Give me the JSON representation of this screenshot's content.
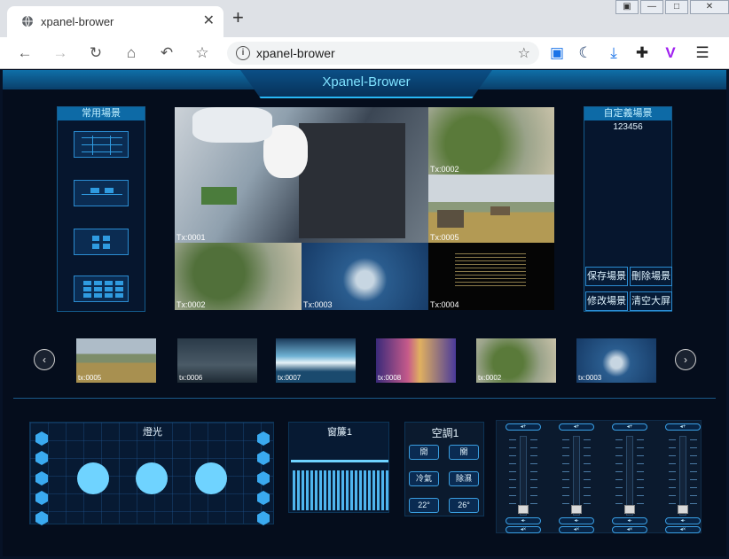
{
  "browser": {
    "tab_title": "xpanel-brower",
    "tab_close": "✕",
    "new_tab": "+",
    "url": "xpanel-brower",
    "window_controls": [
      "▣",
      "—",
      "□",
      "✕"
    ]
  },
  "app": {
    "title": "Xpanel-Brower",
    "common_scenes": {
      "title": "常用場景"
    },
    "custom_scenes": {
      "title": "自定義場景",
      "items": [
        "123456"
      ],
      "buttons": [
        "保存場景",
        "刪除場景",
        "修改場景",
        "清空大屏"
      ]
    },
    "video_wall": {
      "tiles": [
        "Tx:0001",
        "Tx:0002",
        "Tx:0005",
        "Tx:0002",
        "Tx:0003",
        "Tx:0004"
      ]
    },
    "source_strip": {
      "prev": "‹",
      "next": "›",
      "thumbs": [
        "tx:0005",
        "tx:0006",
        "tx:0007",
        "tx:0008",
        "tx:0002",
        "tx:0003"
      ]
    },
    "lighting": {
      "title": "燈光"
    },
    "curtain": {
      "title": "窗簾1",
      "level": 0.82
    },
    "ac": {
      "title": "空調1",
      "buttons": [
        "開",
        "關",
        "冷氣",
        "除濕",
        "22°",
        "26°"
      ]
    },
    "mixer": {
      "channels": 4
    }
  },
  "colors": {
    "accent": "#28b7f5",
    "bulb": "#6fd3ff",
    "panel": "#071a33"
  }
}
